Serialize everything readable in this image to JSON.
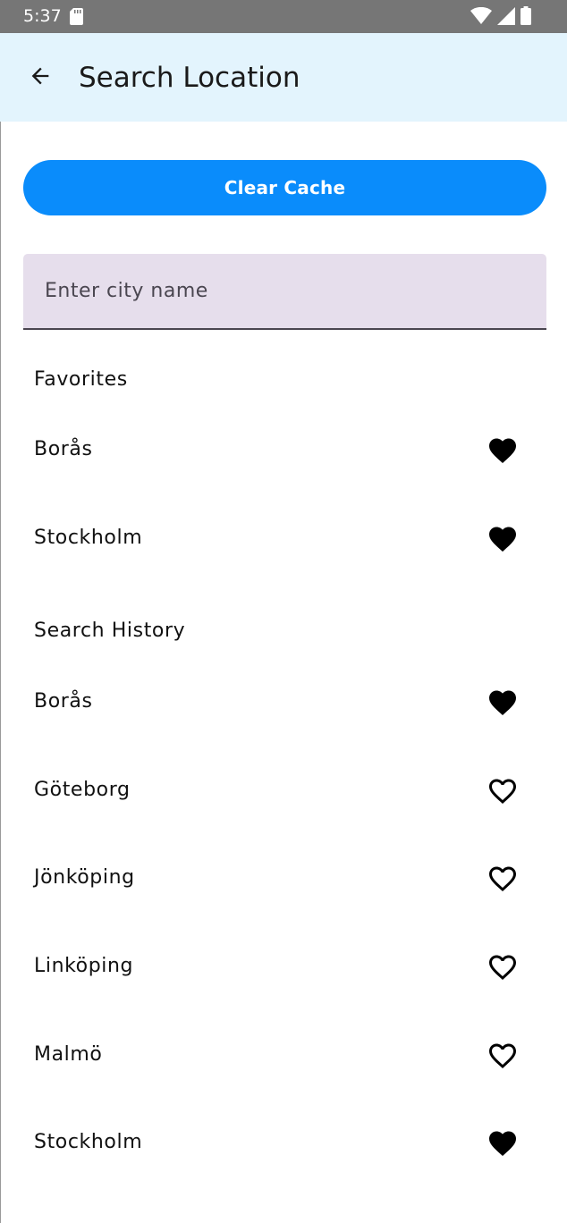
{
  "status_bar": {
    "time": "5:37"
  },
  "app_bar": {
    "title": "Search Location"
  },
  "clear_cache_label": "Clear Cache",
  "search": {
    "placeholder": "Enter city name"
  },
  "favorites": {
    "heading": "Favorites",
    "items": [
      {
        "label": "Borås",
        "favorite": true
      },
      {
        "label": "Stockholm",
        "favorite": true
      }
    ]
  },
  "history": {
    "heading": "Search History",
    "items": [
      {
        "label": "Borås",
        "favorite": true
      },
      {
        "label": "Göteborg",
        "favorite": false
      },
      {
        "label": "Jönköping",
        "favorite": false
      },
      {
        "label": "Linköping",
        "favorite": false
      },
      {
        "label": "Malmö",
        "favorite": false
      },
      {
        "label": "Stockholm",
        "favorite": true
      }
    ]
  },
  "colors": {
    "app_bar_bg": "#e3f4fd",
    "accent_button": "#0a8cfb",
    "search_field_bg": "#e6deec",
    "status_bar_bg": "#767676"
  }
}
